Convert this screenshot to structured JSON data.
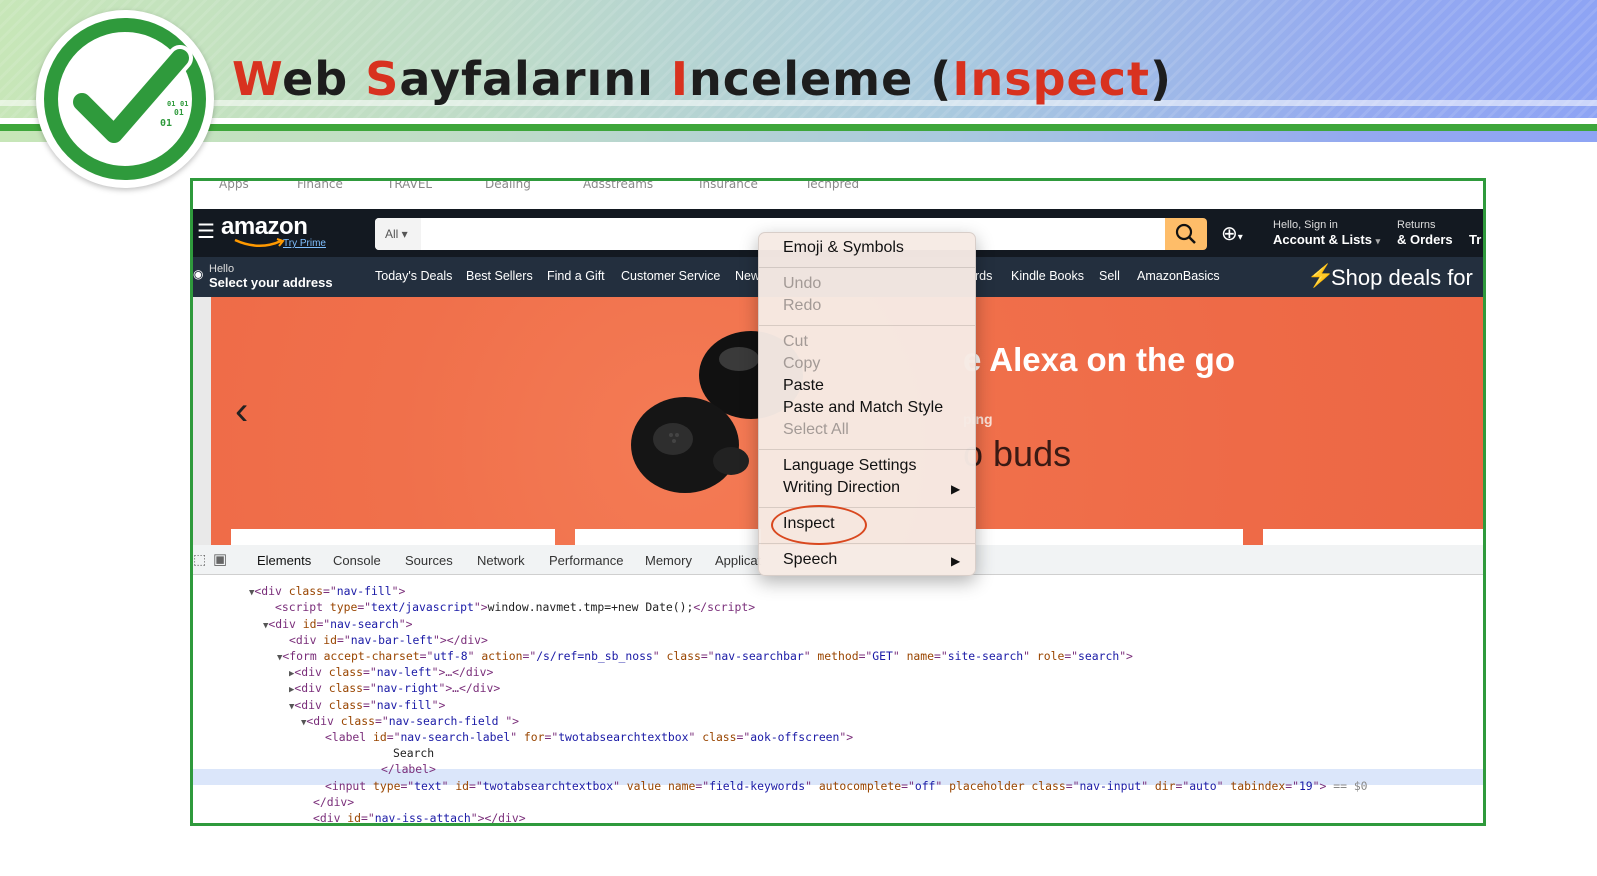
{
  "slide": {
    "title_parts": [
      {
        "text": "W",
        "red": true
      },
      {
        "text": "eb ",
        "red": false
      },
      {
        "text": "S",
        "red": true
      },
      {
        "text": "ayfalarını ",
        "red": false
      },
      {
        "text": "I",
        "red": true
      },
      {
        "text": "nceleme (",
        "red": false
      },
      {
        "text": "Inspect",
        "red": true
      },
      {
        "text": ")",
        "red": false
      }
    ],
    "logo_digits": [
      "01",
      "01",
      "01",
      "01"
    ]
  },
  "bookmarks": [
    "Apps",
    "Finance",
    "TRAVEL",
    "Dealing",
    "Adsstreams",
    "Insurance",
    "Techpred"
  ],
  "amazon": {
    "logo": "amazon",
    "try_prime": "Try Prime",
    "search_category": "All",
    "hello": "Hello",
    "address": "Select your address",
    "hello_sign_in": "Hello, Sign in",
    "account_lists": "Account & Lists",
    "returns": "Returns",
    "orders": "& Orders",
    "cart_partial": "Tr",
    "nav_links": [
      "Today's Deals",
      "Best Sellers",
      "Find a Gift",
      "Customer Service",
      "New"
    ],
    "nav_links_right": [
      "rds",
      "Kindle Books",
      "Sell",
      "AmazonBasics"
    ],
    "shop_deals": "Shop deals for",
    "hero_line1": "e Alexa on the go",
    "hero_line2": "ping",
    "hero_line3": "o buds"
  },
  "devtools": {
    "tabs": [
      "Elements",
      "Console",
      "Sources",
      "Network",
      "Performance",
      "Memory",
      "Applicat"
    ],
    "selected_tab": "Elements"
  },
  "context_menu": {
    "items": [
      {
        "label": "Emoji & Symbols",
        "enabled": true
      },
      {
        "label": "Undo",
        "enabled": false
      },
      {
        "label": "Redo",
        "enabled": false
      },
      {
        "label": "Cut",
        "enabled": false
      },
      {
        "label": "Copy",
        "enabled": false
      },
      {
        "label": "Paste",
        "enabled": true
      },
      {
        "label": "Paste and Match Style",
        "enabled": true
      },
      {
        "label": "Select All",
        "enabled": false
      },
      {
        "label": "Language Settings",
        "enabled": true
      },
      {
        "label": "Writing Direction",
        "enabled": true,
        "submenu": true
      },
      {
        "label": "Inspect",
        "enabled": true,
        "highlighted": true
      },
      {
        "label": "Speech",
        "enabled": true,
        "submenu": true
      }
    ]
  },
  "code_lines": [
    {
      "indent": 0,
      "tri": "",
      "html": "<span class=\"g\">       </span>"
    },
    {
      "indent": 56,
      "tri": "▼",
      "html": "&lt;div <span class=\"a\">class</span>=\"<span class=\"v\">nav-fill</span>\"&gt;"
    },
    {
      "indent": 82,
      "tri": "",
      "html": "&lt;script <span class=\"a\">type</span>=\"<span class=\"v\">text/javascript</span>\"&gt;<span class=\"t\">window.navmet.tmp=+new Date();</span>&lt;/script&gt;"
    },
    {
      "indent": 70,
      "tri": "▼",
      "html": "&lt;div <span class=\"a\">id</span>=\"<span class=\"v\">nav-search</span>\"&gt;"
    },
    {
      "indent": 96,
      "tri": "",
      "html": "&lt;div <span class=\"a\">id</span>=\"<span class=\"v\">nav-bar-left</span>\"&gt;&lt;/div&gt;"
    },
    {
      "indent": 84,
      "tri": "▼",
      "html": "&lt;form <span class=\"a\">accept-charset</span>=\"<span class=\"v\">utf-8</span>\" <span class=\"a\">action</span>=\"<span class=\"v\">/s/ref=nb_sb_noss</span>\" <span class=\"a\">class</span>=\"<span class=\"v\">nav-searchbar</span>\" <span class=\"a\">method</span>=\"<span class=\"v\">GET</span>\" <span class=\"a\">name</span>=\"<span class=\"v\">site-search</span>\" <span class=\"a\">role</span>=\"<span class=\"v\">search</span>\"&gt;"
    },
    {
      "indent": 96,
      "tri": "▶",
      "html": "&lt;div <span class=\"a\">class</span>=\"<span class=\"v\">nav-left</span>\"&gt;…&lt;/div&gt;"
    },
    {
      "indent": 96,
      "tri": "▶",
      "html": "&lt;div <span class=\"a\">class</span>=\"<span class=\"v\">nav-right</span>\"&gt;…&lt;/div&gt;"
    },
    {
      "indent": 96,
      "tri": "▼",
      "html": "&lt;div <span class=\"a\">class</span>=\"<span class=\"v\">nav-fill</span>\"&gt;"
    },
    {
      "indent": 108,
      "tri": "▼",
      "html": "&lt;div <span class=\"a\">class</span>=\"<span class=\"v\">nav-search-field </span>\"&gt;"
    },
    {
      "indent": 132,
      "tri": "",
      "html": "&lt;label <span class=\"a\">id</span>=\"<span class=\"v\">nav-search-label</span>\" <span class=\"a\">for</span>=\"<span class=\"v\">twotabsearchtextbox</span>\" <span class=\"a\">class</span>=\"<span class=\"v\">aok-offscreen</span>\"&gt;"
    },
    {
      "indent": 200,
      "tri": "",
      "html": "<span class=\"t\">Search</span>"
    },
    {
      "indent": 188,
      "tri": "",
      "html": "&lt;/label&gt;"
    },
    {
      "indent": 132,
      "tri": "",
      "html": "&lt;input <span class=\"a\">type</span>=\"<span class=\"v\">text</span>\" <span class=\"a\">id</span>=\"<span class=\"v\">twotabsearchtextbox</span>\" <span class=\"a\">value name</span>=\"<span class=\"v\">field-keywords</span>\" <span class=\"a\">autocomplete</span>=\"<span class=\"v\">off</span>\" <span class=\"a\">placeholder class</span>=\"<span class=\"v\">nav-input</span>\" <span class=\"a\">dir</span>=\"<span class=\"v\">auto</span>\" <span class=\"a\">tabindex</span>=\"<span class=\"v\">19</span>\"&gt; <span class=\"g\">== $0</span>"
    },
    {
      "indent": 120,
      "tri": "",
      "html": "&lt;/div&gt;"
    },
    {
      "indent": 120,
      "tri": "",
      "html": "&lt;div <span class=\"a\">id</span>=\"<span class=\"v\">nav-iss-attach</span>\"&gt;&lt;/div&gt;"
    }
  ]
}
